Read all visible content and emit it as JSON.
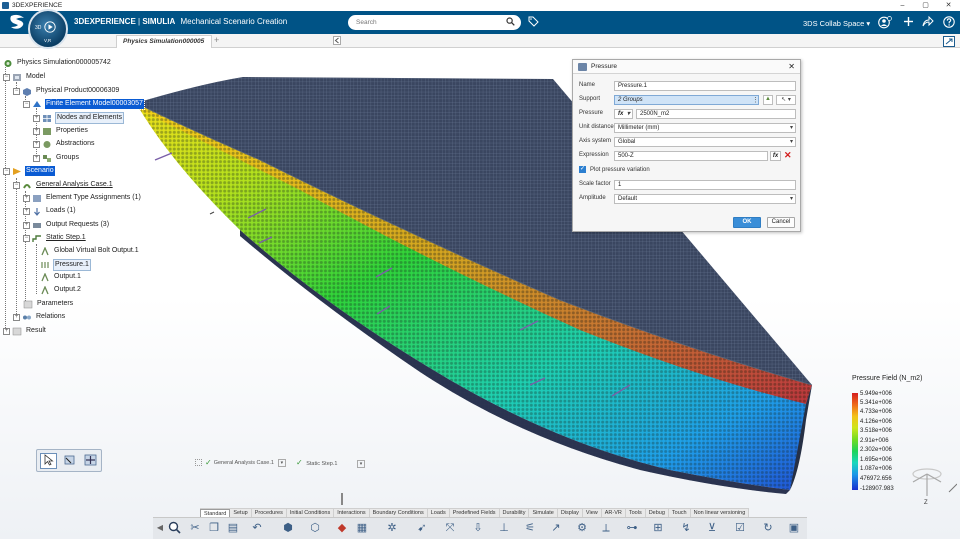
{
  "window": {
    "title": "3DEXPERIENCE",
    "controls": [
      "–",
      "▢",
      "✕"
    ]
  },
  "topbar": {
    "brand_prefix": "3DEXPERIENCE",
    "brand_sep": " | ",
    "brand_product": "SIMULIA",
    "brand_app": "Mechanical Scenario Creation",
    "search_placeholder": "Search",
    "collab_space": "3DS Collab Space",
    "collab_chevron": "▾"
  },
  "compass": {
    "badge": "3D",
    "vr": "V,R"
  },
  "tabs": {
    "active": "Physics Simulation000005",
    "add": "+"
  },
  "tree": {
    "root": "Physics Simulation000005742",
    "model": "Model",
    "product": "Physical Product00006309",
    "fem": "Finite Element Model00003057",
    "nodes": "Nodes and Elements",
    "properties": "Properties",
    "abstractions": "Abstractions",
    "groups": "Groups",
    "scenario": "Scenario",
    "analysis_case": "General Analysis Case.1",
    "element_type": "Element Type Assignments (1)",
    "loads": "Loads (1)",
    "output_requests": "Output Requests (3)",
    "static_step": "Static Step.1",
    "gvb_output": "Global Virtual Bolt Output.1",
    "pressure": "Pressure.1",
    "output1": "Output.1",
    "output2": "Output.2",
    "parameters": "Parameters",
    "relations": "Relations",
    "result": "Result"
  },
  "dialog": {
    "title": "Pressure",
    "name_label": "Name",
    "name_value": "Pressure.1",
    "support_label": "Support",
    "support_value": "2 Groups",
    "pressure_label": "Pressure",
    "pressure_fx": "fx",
    "pressure_value": "2500N_m2",
    "unit_label": "Unit distance",
    "unit_value": "Millimeter (mm)",
    "axis_label": "Axis system",
    "axis_value": "Global",
    "expr_label": "Expression",
    "expr_value": "500-Z",
    "expr_fx": "fx",
    "plot_label": "Plot pressure variation",
    "scale_label": "Scale factor",
    "scale_value": "1",
    "amp_label": "Amplitude",
    "amp_value": "Default",
    "ok": "OK",
    "cancel": "Cancel"
  },
  "legend": {
    "title": "Pressure Field (N_m2)",
    "ticks": [
      "5.949e+006",
      "5.341e+006",
      "4.733e+006",
      "4.126e+006",
      "3.518e+006",
      "2.91e+006",
      "2.302e+006",
      "1.695e+006",
      "1.087e+006",
      "476972.656",
      "-128907.983"
    ]
  },
  "triad": {
    "axis_z": "Z"
  },
  "status": {
    "case": "General Analysis Case.1",
    "step": "Static Step.1"
  },
  "app_tabs": [
    "Standard",
    "Setup",
    "Procedures",
    "Initial Conditions",
    "Interactions",
    "Boundary Conditions",
    "Loads",
    "Predefined Fields",
    "Durability",
    "Simulate",
    "Display",
    "View",
    "AR-VR",
    "Tools",
    "Debug",
    "Touch",
    "Non linear versioning"
  ],
  "active_app_tab": "Standard",
  "colors": {
    "topbar": "#005386",
    "selection": "#0a5bd3",
    "ok_button": "#3a8ed8"
  }
}
